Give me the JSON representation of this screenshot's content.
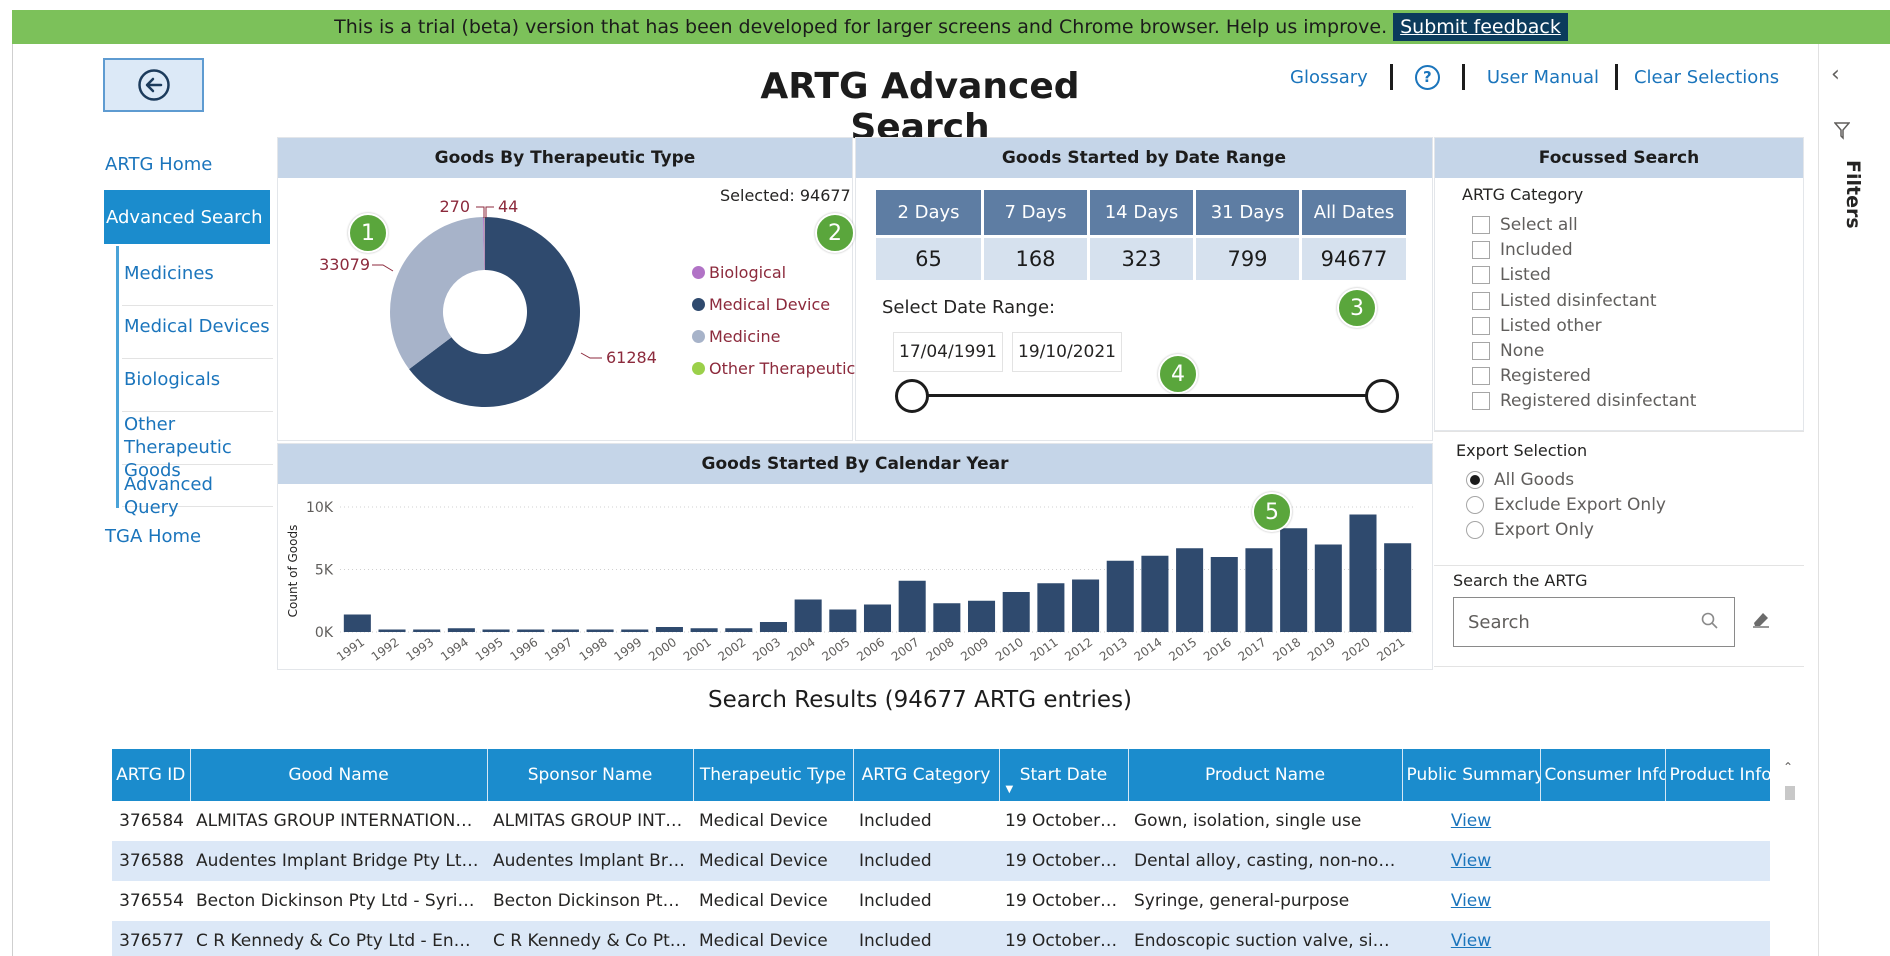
{
  "banner": {
    "text": "This is a trial (beta) version that has been developed for larger screens and Chrome browser. Help us improve.",
    "link_label": "Submit feedback"
  },
  "header": {
    "title": "ARTG Advanced Search",
    "glossary": "Glossary",
    "help_icon": "?",
    "user_manual": "User Manual",
    "clear_selections": "Clear Selections"
  },
  "filters_pane": {
    "label": "Filters",
    "collapse_icon": "chevron-left-icon",
    "funnel_icon": "funnel-icon"
  },
  "nav": {
    "home": "ARTG Home",
    "active": "Advanced Search",
    "sub_items": [
      "Medicines",
      "Medical Devices",
      "Biologicals",
      "Other Therapeutic Goods",
      "Advanced Query"
    ],
    "tga_home": "TGA Home"
  },
  "badges": [
    "1",
    "2",
    "3",
    "4",
    "5"
  ],
  "therapeutic_panel": {
    "title": "Goods By Therapeutic Type",
    "selected_label": "Selected: 94677",
    "legend": [
      {
        "label": "Biological",
        "color": "#b173c6"
      },
      {
        "label": "Medical Device",
        "color": "#2f4a6e"
      },
      {
        "label": "Medicine",
        "color": "#a7b3c9"
      },
      {
        "label": "Other Therapeutic",
        "color": "#9bd04a"
      }
    ],
    "slice_labels": [
      "61284",
      "33079",
      "270",
      "44"
    ]
  },
  "date_panel": {
    "title": "Goods Started by Date Range",
    "ranges": [
      {
        "label": "2 Days",
        "value": "65"
      },
      {
        "label": "7 Days",
        "value": "168"
      },
      {
        "label": "14 Days",
        "value": "323"
      },
      {
        "label": "31 Days",
        "value": "799"
      },
      {
        "label": "All Dates",
        "value": "94677"
      }
    ],
    "select_label": "Select Date Range:",
    "start_date": "17/04/1991",
    "end_date": "19/10/2021",
    "slider_start": 0,
    "slider_end": 1
  },
  "focussed": {
    "title": "Focussed Search",
    "category_label": "ARTG Category",
    "categories": [
      "Select all",
      "Included",
      "Listed",
      "Listed disinfectant",
      "Listed other",
      "None",
      "Registered",
      "Registered disinfectant"
    ],
    "export_label": "Export Selection",
    "export_options": [
      "All Goods",
      "Exclude Export Only",
      "Export Only"
    ],
    "export_selected": "All Goods",
    "search_label": "Search the ARTG",
    "search_placeholder": "Search"
  },
  "calendar_panel": {
    "title": "Goods Started By Calendar Year"
  },
  "colors": {
    "accent": "#1b8ccd",
    "navy": "#2f4a6e",
    "header_band": "#c5d5e8",
    "banner": "#7cc15a",
    "badge": "#5aa63c"
  },
  "chart_data": [
    {
      "type": "pie",
      "title": "Goods By Therapeutic Type",
      "categories": [
        "Medical Device",
        "Medicine",
        "Biological",
        "Other Therapeutic"
      ],
      "values": [
        61284,
        33079,
        270,
        44
      ]
    },
    {
      "type": "bar",
      "title": "Goods Started By Calendar Year",
      "ylabel": "Count of Goods",
      "yticks": [
        "0K",
        "5K",
        "10K"
      ],
      "ylim": [
        0,
        10000
      ],
      "categories": [
        "1991",
        "1992",
        "1993",
        "1994",
        "1995",
        "1996",
        "1997",
        "1998",
        "1999",
        "2000",
        "2001",
        "2002",
        "2003",
        "2004",
        "2005",
        "2006",
        "2007",
        "2008",
        "2009",
        "2010",
        "2011",
        "2012",
        "2013",
        "2014",
        "2015",
        "2016",
        "2017",
        "2018",
        "2019",
        "2020",
        "2021"
      ],
      "values": [
        1400,
        200,
        200,
        300,
        200,
        200,
        200,
        200,
        200,
        400,
        300,
        300,
        800,
        2600,
        1800,
        2200,
        4100,
        2300,
        2500,
        3200,
        3900,
        4200,
        5700,
        6100,
        6700,
        6000,
        6700,
        8300,
        7000,
        9400,
        7100
      ]
    }
  ],
  "results": {
    "title": "Search Results (94677 ARTG entries)",
    "columns": [
      "ARTG ID",
      "Good Name",
      "Sponsor Name",
      "Therapeutic Type",
      "ARTG Category",
      "Start Date",
      "Product Name",
      "Public Summary",
      "Consumer Info",
      "Product Info"
    ],
    "rows": [
      [
        "376584",
        "ALMITAS GROUP INTERNATIONAL...",
        "ALMITAS GROUP INTE...",
        "Medical Device",
        "Included",
        "19 October 2...",
        "Gown, isolation, single use",
        "View",
        "",
        ""
      ],
      [
        "376588",
        "Audentes Implant Bridge Pty Ltd - ...",
        "Audentes Implant Brid...",
        "Medical Device",
        "Included",
        "19 October 2...",
        "Dental alloy, casting, non-noble",
        "View",
        "",
        ""
      ],
      [
        "376554",
        "Becton Dickinson Pty Ltd - Syringe...",
        "Becton Dickinson Pty L...",
        "Medical Device",
        "Included",
        "19 October 2...",
        "Syringe, general-purpose",
        "View",
        "",
        ""
      ],
      [
        "376577",
        "C R Kennedy & Co Pty Ltd - Endos...",
        "C R Kennedy & Co Pty ...",
        "Medical Device",
        "Included",
        "19 October 2...",
        "Endoscopic suction valve, singl...",
        "View",
        "",
        ""
      ]
    ]
  }
}
